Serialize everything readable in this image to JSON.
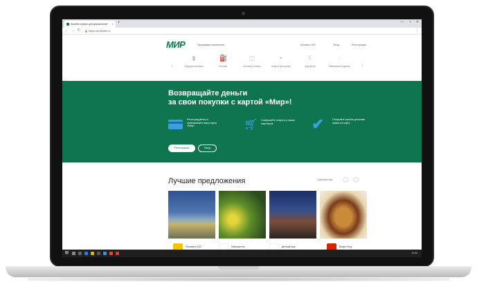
{
  "browser": {
    "tab_title": "Кешбэк сервис для держателей",
    "tab_close": "×",
    "new_tab": "+",
    "url": "https://privetmir.ru",
    "lock": "🔒",
    "back": "←",
    "forward": "→",
    "reload": "C",
    "menu": "⋮",
    "win_min": "—",
    "win_max": "□",
    "win_close": "✕"
  },
  "header": {
    "logo": "МИР",
    "subtitle": "Программа лояльности",
    "links": [
      "Москва и МО",
      "Вход",
      "Регистрация"
    ]
  },
  "categories": {
    "prev": "‹",
    "next": "›",
    "items": [
      {
        "label": "Продукты питания",
        "icon": "bottle-icon",
        "glyph": "▮"
      },
      {
        "label": "Топливо",
        "icon": "fuel-icon",
        "glyph": "⛽"
      },
      {
        "label": "Бытовая техника",
        "icon": "appliance-icon",
        "glyph": "◫"
      },
      {
        "label": "Кафе и рестораны",
        "icon": "cloche-icon",
        "glyph": "◓"
      },
      {
        "label": "Для детей",
        "icon": "bear-icon",
        "glyph": "ʕ"
      },
      {
        "label": "Ювелирные изделия",
        "icon": "ring-icon",
        "glyph": "◌"
      }
    ]
  },
  "hero": {
    "title_line1": "Возвращайте деньги",
    "title_line2": "за свои покупки с картой «Мир»!",
    "steps": [
      {
        "text": "Регистрируйтесь и привязывайте вашу карту «Мир»",
        "icon": "card-icon"
      },
      {
        "text": "Совершайте покупки у наших партнеров",
        "icon": "cart-icon"
      },
      {
        "text": "Получайте кэшбэк деньгами прямо на карту",
        "icon": "check-icon"
      }
    ],
    "btn_primary": "Регистрация",
    "btn_secondary": "Вход",
    "colors": {
      "bg": "#0f754e",
      "accent": "#3aa0e0"
    }
  },
  "offers": {
    "title": "Лучшие предложения",
    "see_all": "Смотреть все",
    "prev": "‹",
    "next": "›",
    "brands": [
      {
        "name": "Роснефть АЗС",
        "color": "#f5c400"
      },
      {
        "name": "Перекресток",
        "color": "#ffffff"
      },
      {
        "name": "Детский мир",
        "color": "#ffffff"
      },
      {
        "name": "Burger King",
        "color": "#d62300"
      }
    ]
  },
  "taskbar": {
    "start": "⊞",
    "time": "12:00"
  }
}
